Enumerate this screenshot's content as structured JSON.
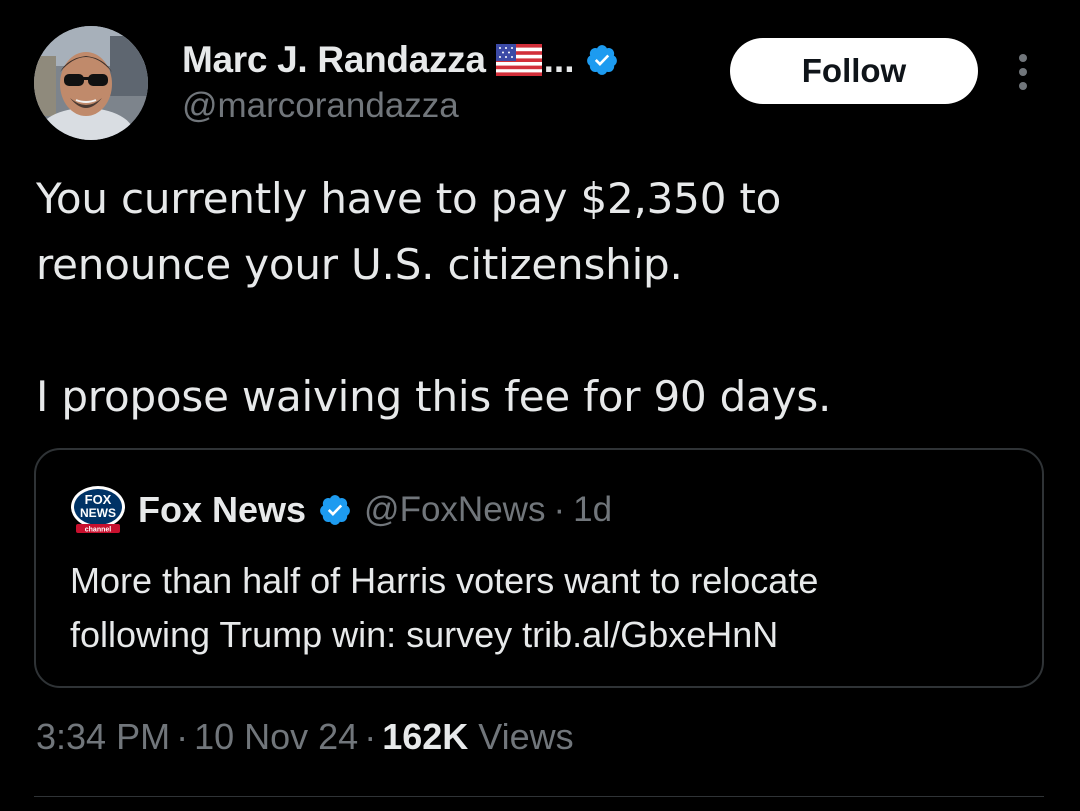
{
  "author": {
    "display_name": "Marc J. Randazza",
    "name_truncation": "...",
    "handle": "@marcorandazza",
    "avatar_icon": "avatar-photo",
    "flag_icon": "us-flag-icon",
    "verified_icon": "verified-badge-icon"
  },
  "actions": {
    "follow_label": "Follow",
    "more_icon": "more-vertical-icon"
  },
  "tweet": {
    "paragraphs": [
      "You currently have to pay $2,350 to",
      "renounce your U.S. citizenship.",
      "I propose waiving this fee for 90 days."
    ]
  },
  "quote": {
    "logo_icon": "fox-news-logo-icon",
    "logo_lines": [
      "FOX",
      "NEWS",
      "channel"
    ],
    "name": "Fox News",
    "handle": "@FoxNews",
    "dot": "·",
    "time": "1d",
    "text_lines": [
      "More than half of Harris voters want to relocate",
      "following Trump win: survey trib.al/GbxeHnN"
    ]
  },
  "meta": {
    "time": "3:34 PM",
    "sep": "·",
    "date": "10 Nov 24",
    "views_count": "162K",
    "views_label": "Views"
  },
  "colors": {
    "background": "#000000",
    "primary_text": "#e7e9ea",
    "secondary_text": "#71767b",
    "border": "#2f3336",
    "verified_blue": "#1d9bf0",
    "follow_bg": "#ffffff"
  }
}
